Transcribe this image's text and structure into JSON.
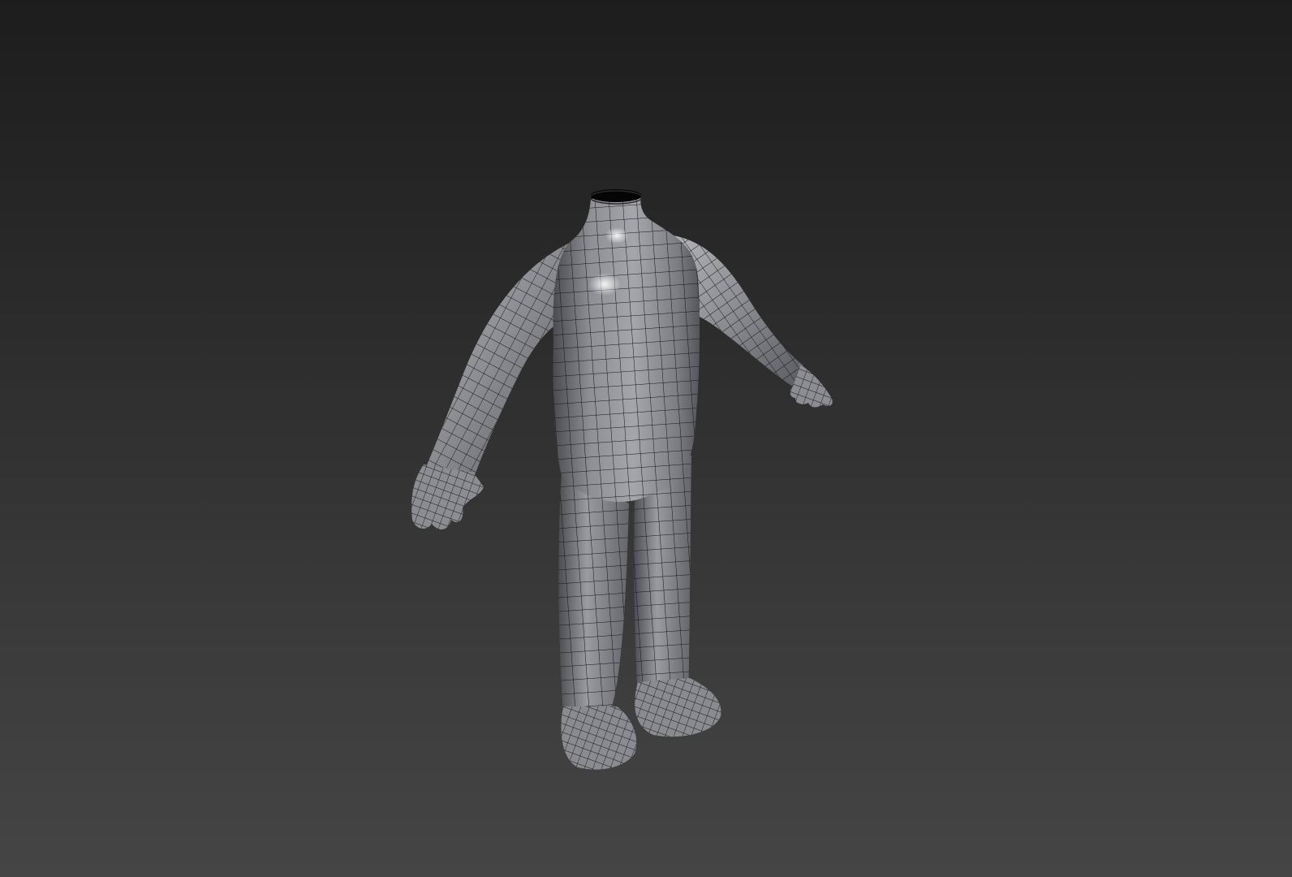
{
  "viewport": {
    "background_top": "#1d1d1d",
    "background_bottom": "#454545"
  },
  "model": {
    "kind": "headless-character-base-mesh",
    "display_mode": "shaded-with-wireframe",
    "surface_color": "#8f9096",
    "wire_color": "#141414"
  }
}
